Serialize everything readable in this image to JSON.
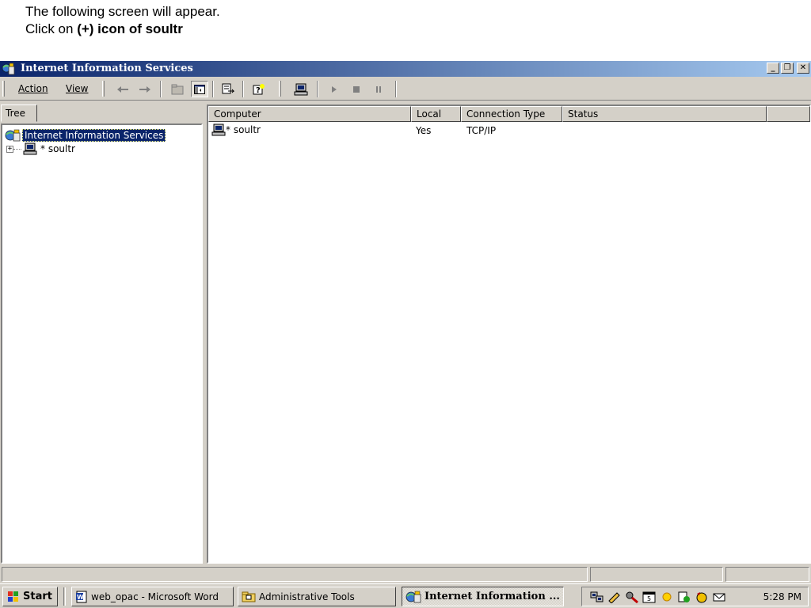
{
  "instructions": {
    "line1": "The following screen will appear.",
    "line2_prefix": "Click on ",
    "line2_bold": "(+) icon of soultr"
  },
  "window": {
    "title": "Internet Information Services",
    "minimize_glyph": "_",
    "restore_glyph": "❐",
    "close_glyph": "✕"
  },
  "menu": {
    "action": "Action",
    "view": "View"
  },
  "tree": {
    "tab_label": "Tree",
    "root_label": "Internet Information Services",
    "expand_glyph": "+",
    "child_label": "* soultr"
  },
  "list": {
    "columns": [
      "Computer",
      "Local",
      "Connection Type",
      "Status"
    ],
    "rows": [
      {
        "computer": "* soultr",
        "local": "Yes",
        "connection_type": "TCP/IP",
        "status": ""
      }
    ]
  },
  "taskbar": {
    "start_label": "Start",
    "tasks": [
      "web_opac - Microsoft Word",
      "Administrative Tools",
      "Internet Information ..."
    ],
    "clock": "5:28 PM"
  },
  "colors": {
    "title_start": "#0a246a",
    "title_end": "#a6caf0",
    "face": "#d4d0c8",
    "selection": "#0a246a"
  }
}
